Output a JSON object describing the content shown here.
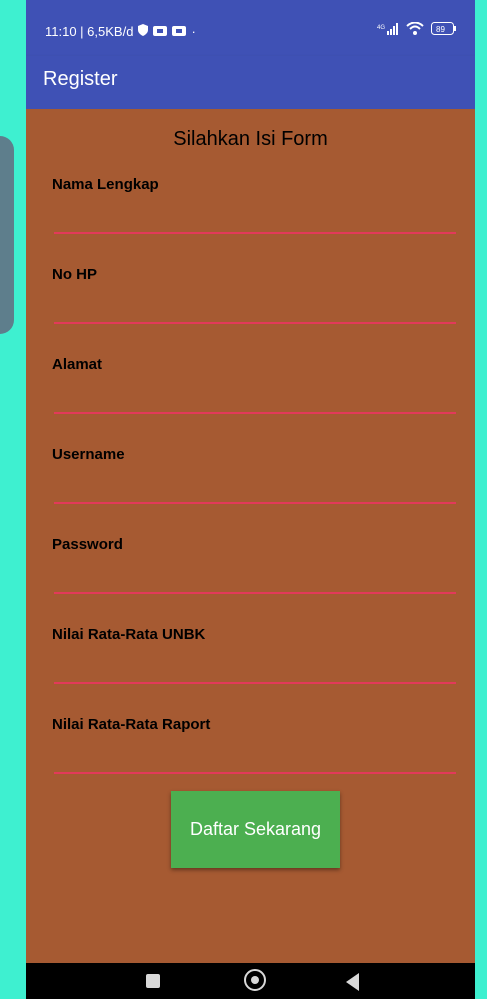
{
  "status_bar": {
    "time_speed": "11:10 | 6,5KB/d",
    "dot": "·",
    "network": "4G",
    "battery": "89"
  },
  "app_bar": {
    "title": "Register"
  },
  "form": {
    "title": "Silahkan Isi Form",
    "fields": [
      {
        "label": "Nama Lengkap"
      },
      {
        "label": "No HP"
      },
      {
        "label": "Alamat"
      },
      {
        "label": "Username"
      },
      {
        "label": "Password"
      },
      {
        "label": "Nilai Rata-Rata UNBK"
      },
      {
        "label": "Nilai Rata-Rata Raport"
      }
    ],
    "submit_label": "Daftar Sekarang"
  },
  "colors": {
    "app_bar": "#3f51b5",
    "form_background": "#a65a32",
    "button": "#4caf50",
    "field_underline": "#e23a5a"
  }
}
